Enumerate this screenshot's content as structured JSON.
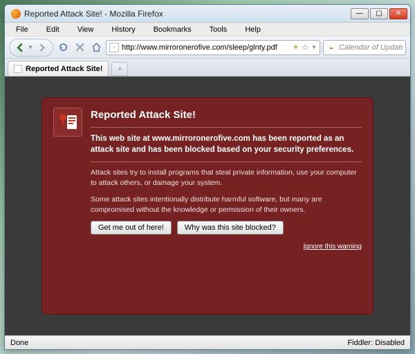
{
  "window": {
    "title": "Reported Attack Site! - Mozilla Firefox"
  },
  "menu": {
    "file": "File",
    "edit": "Edit",
    "view": "View",
    "history": "History",
    "bookmarks": "Bookmarks",
    "tools": "Tools",
    "help": "Help"
  },
  "toolbar": {
    "url": "http://www.mirroronerofive.com/sleep/glnty.pdf",
    "search_placeholder": "Calendar of Updates"
  },
  "tab": {
    "label": "Reported Attack Site!"
  },
  "warning": {
    "heading": "Reported Attack Site!",
    "lead": "This web site at www.mirroronerofive.com has been reported as an attack site and has been blocked based on your security preferences.",
    "para1": "Attack sites try to install programs that steal private information, use your computer to attack others, or damage your system.",
    "para2": "Some attack sites intentionally distribute harmful software, but many are compromised without the knowledge or permission of their owners.",
    "btn_out": "Get me out of here!",
    "btn_why": "Why was this site blocked?",
    "ignore": "Ignore this warning"
  },
  "status": {
    "left": "Done",
    "right": "Fiddler: Disabled"
  }
}
